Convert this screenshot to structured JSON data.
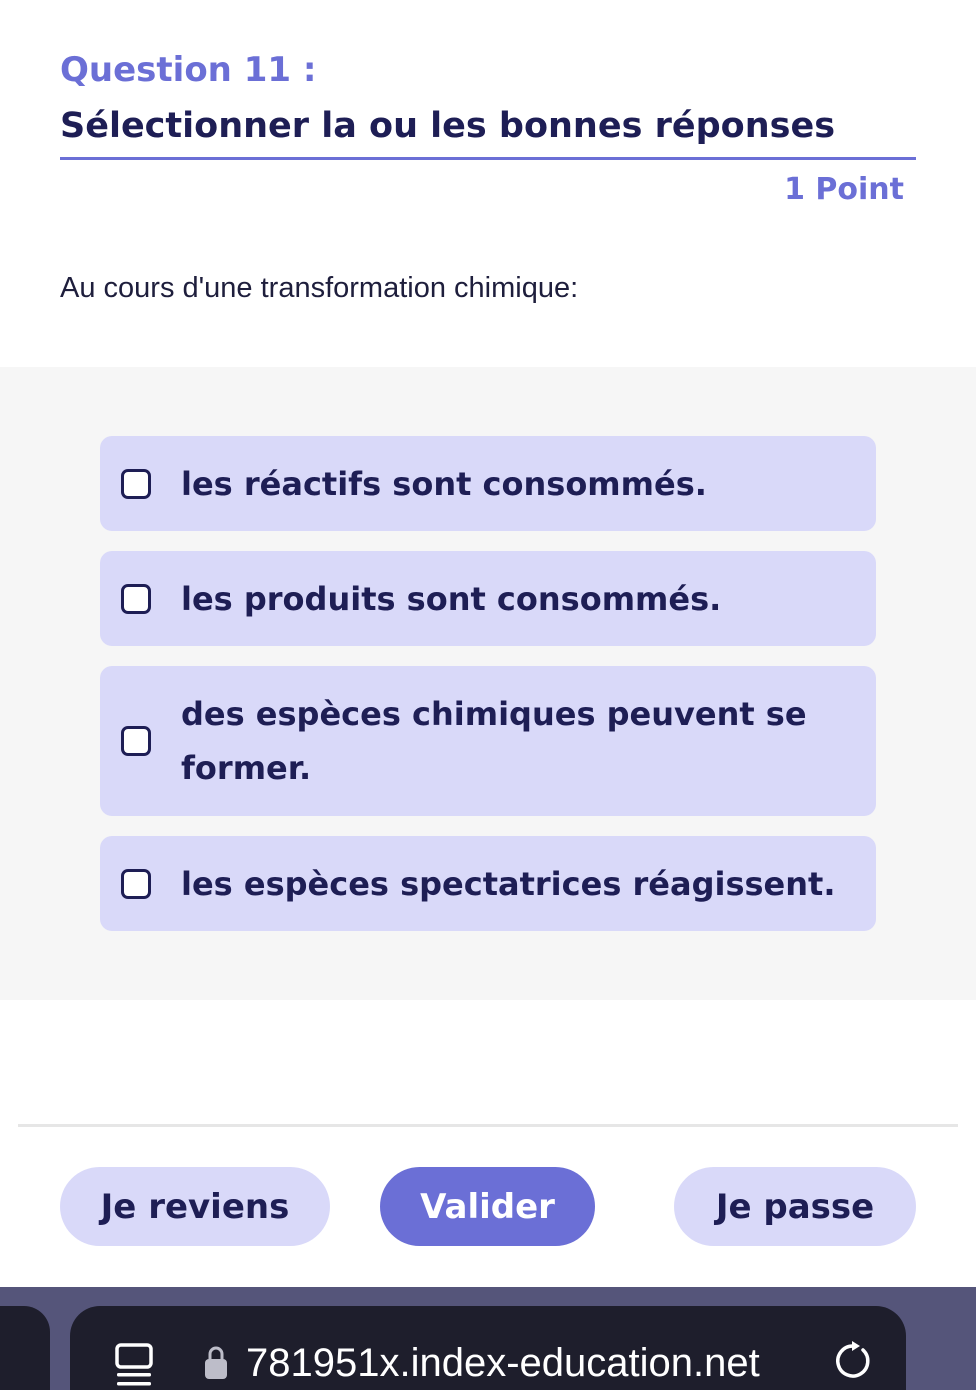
{
  "question": {
    "number": "Question 11 :",
    "instruction": "Sélectionner la ou les bonnes réponses",
    "points": "1 Point",
    "stem": "Au cours d'une transformation chimique:"
  },
  "answers": [
    {
      "label": "les réactifs sont consommés.",
      "checked": false
    },
    {
      "label": "les produits sont consommés.",
      "checked": false
    },
    {
      "label": "des espèces chimiques peuvent se former.",
      "checked": false
    },
    {
      "label": "les espèces spectatrices réagissent.",
      "checked": false
    }
  ],
  "actions": {
    "back_label": "Je reviens",
    "validate_label": "Valider",
    "skip_label": "Je passe"
  },
  "browser": {
    "url": "781951x.index-education.net",
    "icons": {
      "tabs": "tabs-icon",
      "lock": "lock-icon",
      "reload": "reload-icon"
    }
  },
  "colors": {
    "accent": "#6b6fd6",
    "answer_bg": "#d9d9f9",
    "text_dark": "#1e1e55",
    "browser_bg": "#1e1e2c"
  }
}
